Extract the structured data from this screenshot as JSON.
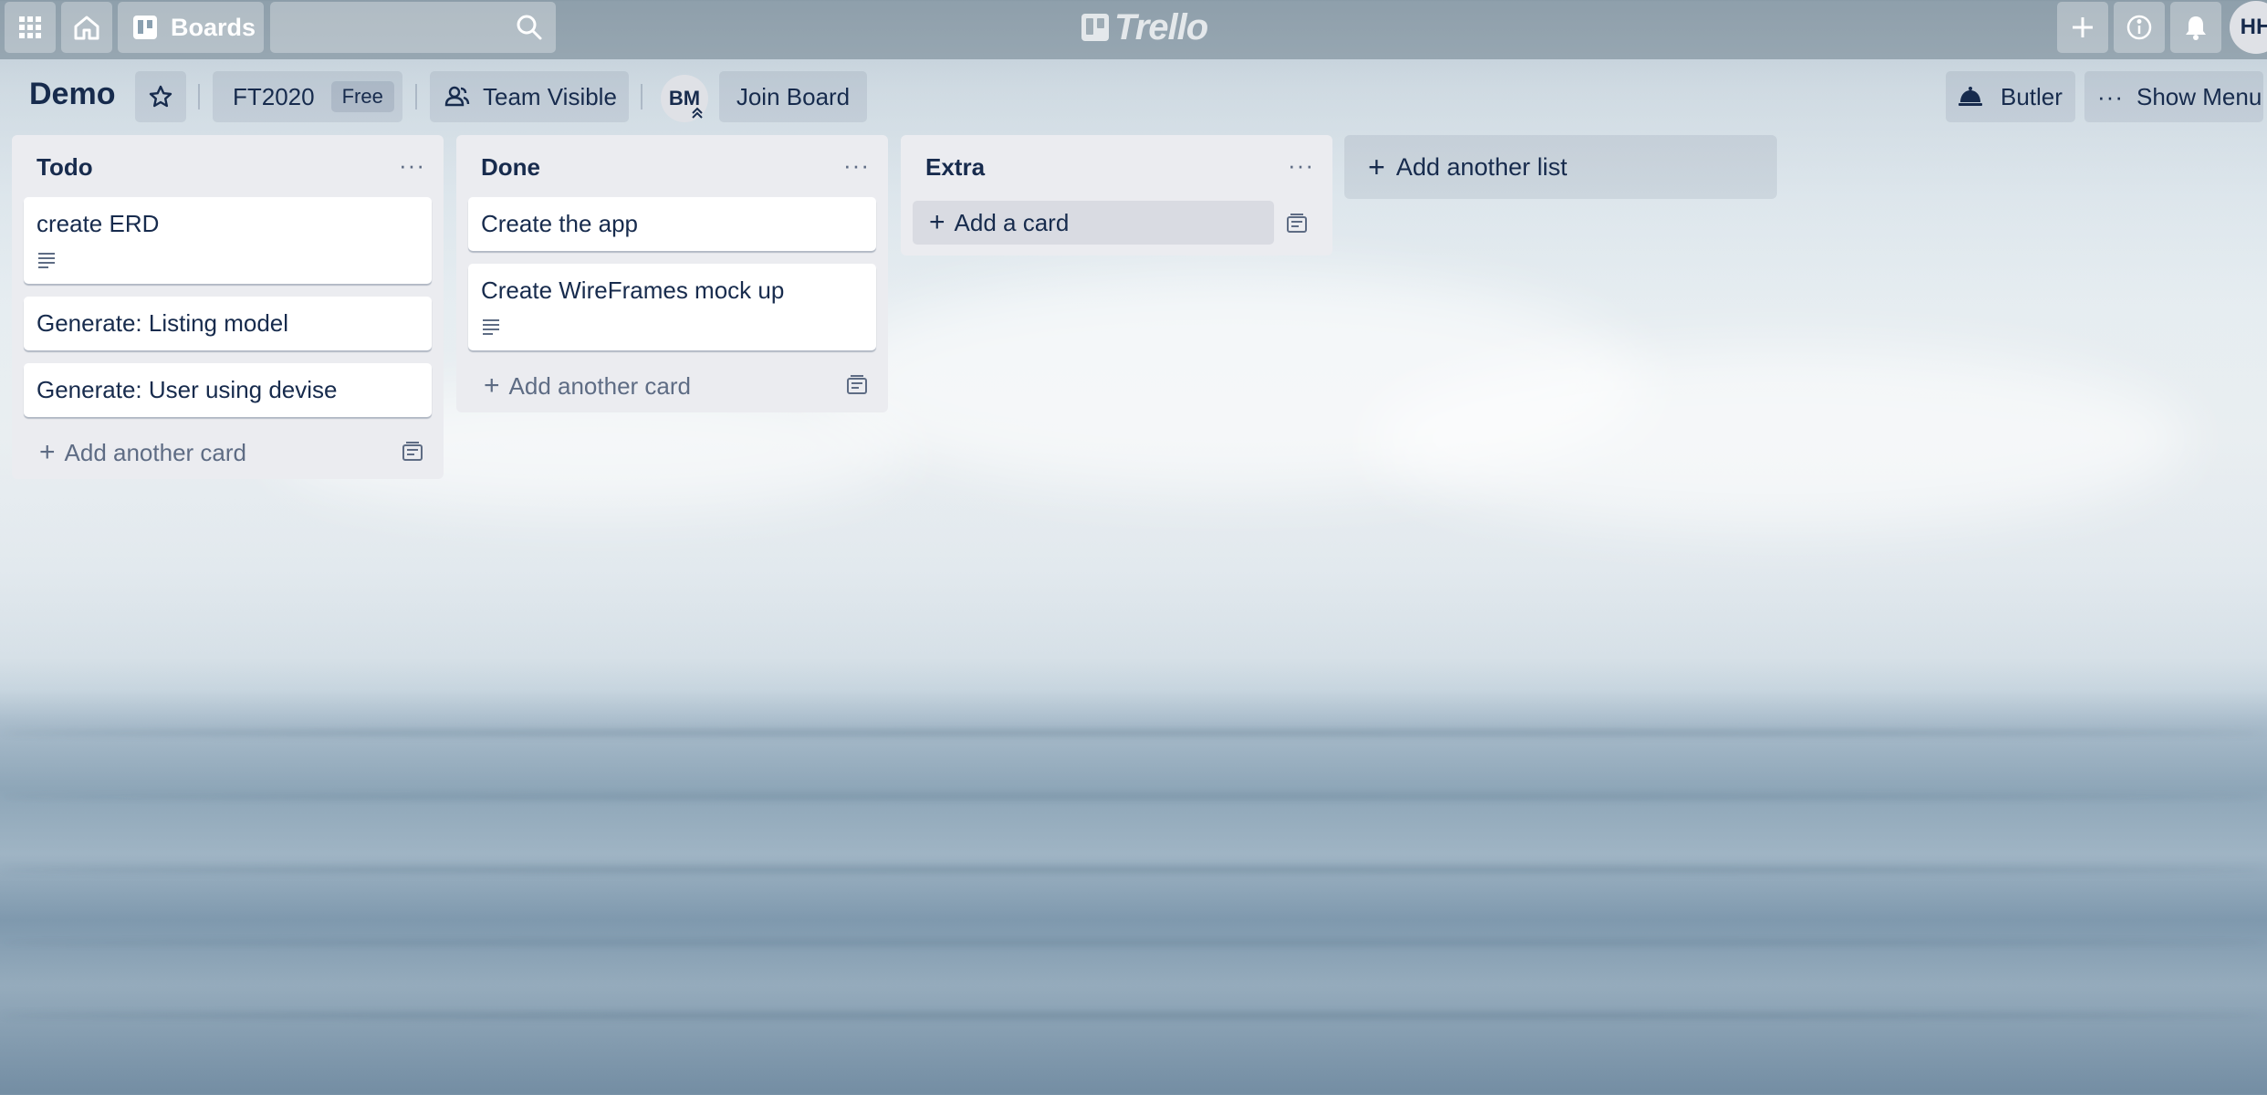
{
  "header": {
    "boards_label": "Boards",
    "search_placeholder": "",
    "logo_text": "Trello",
    "user_initials": "HH"
  },
  "board": {
    "title": "Demo",
    "team_name": "FT2020",
    "team_plan": "Free",
    "visibility": "Team Visible",
    "member_initials": "BM",
    "join_label": "Join Board",
    "butler_label": "Butler",
    "menu_label": "Show Menu"
  },
  "lists": [
    {
      "title": "Todo",
      "cards": [
        {
          "title": "create ERD",
          "has_description": true
        },
        {
          "title": "Generate: Listing model",
          "has_description": false
        },
        {
          "title": "Generate: User using devise",
          "has_description": false
        }
      ],
      "add_label": "Add another card"
    },
    {
      "title": "Done",
      "cards": [
        {
          "title": "Create the app",
          "has_description": false
        },
        {
          "title": "Create WireFrames mock up",
          "has_description": true
        }
      ],
      "add_label": "Add another card"
    },
    {
      "title": "Extra",
      "cards": [],
      "add_label": "Add a card"
    }
  ],
  "add_list_label": "Add another list",
  "colors": {
    "text_primary": "#172b4d",
    "text_muted": "#5e6c84",
    "list_bg": "#ebecf0"
  }
}
